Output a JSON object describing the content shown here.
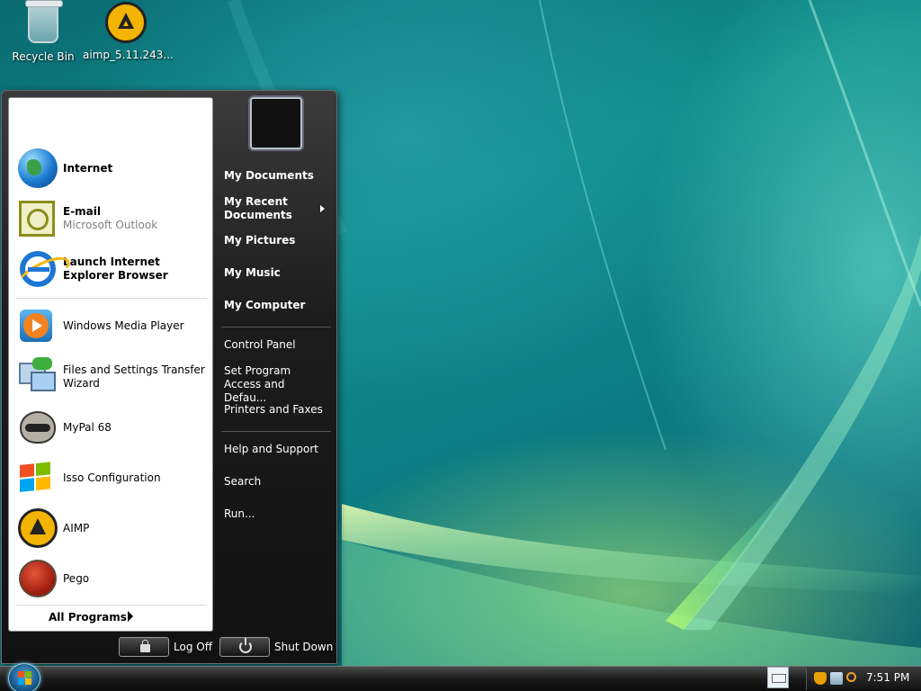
{
  "desktop": {
    "icons": [
      {
        "label": "Recycle Bin"
      },
      {
        "label": "aimp_5.11.243..."
      }
    ]
  },
  "start_menu": {
    "pinned": [
      {
        "label": "Internet",
        "sub": ""
      },
      {
        "label": "E-mail",
        "sub": "Microsoft Outlook"
      },
      {
        "label": "Launch Internet Explorer Browser",
        "sub": ""
      }
    ],
    "recent": [
      {
        "label": "Windows Media Player"
      },
      {
        "label": "Files and Settings Transfer Wizard"
      },
      {
        "label": "MyPal 68"
      },
      {
        "label": "Isso Configuration"
      },
      {
        "label": "AIMP"
      },
      {
        "label": "Pego"
      }
    ],
    "all_programs": "All Programs",
    "right": {
      "my_documents": "My Documents",
      "my_recent_documents": "My Recent Documents",
      "my_pictures": "My Pictures",
      "my_music": "My Music",
      "my_computer": "My Computer",
      "control_panel": "Control Panel",
      "set_program_access": "Set Program Access and Defau...",
      "printers_faxes": "Printers and Faxes",
      "help_support": "Help and Support",
      "search": "Search",
      "run": "Run..."
    },
    "log_off": "Log Off",
    "shut_down": "Shut Down"
  },
  "taskbar": {
    "clock": "7:51 PM"
  },
  "colors": {
    "accent": "#1d76d4",
    "menu_bg": "#1c1c1c",
    "aimp_yellow": "#f2b400"
  }
}
